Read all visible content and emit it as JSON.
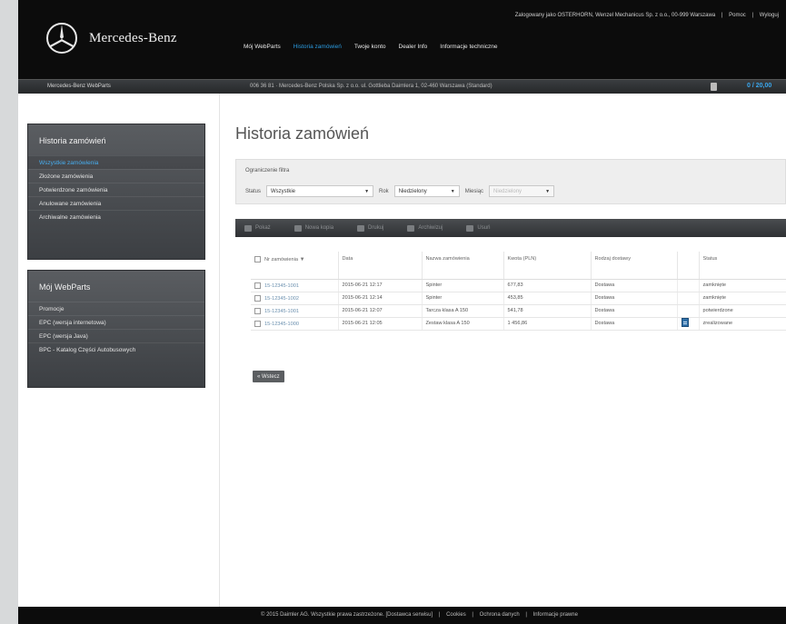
{
  "header": {
    "brand": "Mercedes-Benz",
    "user_info": "Zalogowany jako OSTERHORN, Wenzel Mechanicus Sp. z o.o., 00-999 Warszawa",
    "links": [
      "Pomoc",
      "Wyloguj"
    ],
    "nav": [
      {
        "label": "Mój WebParts",
        "active": false
      },
      {
        "label": "Historia zamówień",
        "active": true
      },
      {
        "label": "Twoje konto",
        "active": false
      },
      {
        "label": "Dealer Info",
        "active": false
      },
      {
        "label": "Informacje techniczne",
        "active": false
      }
    ]
  },
  "subbar": {
    "left": "Mercedes-Benz WebParts",
    "dealer": "006 36 81 · Mercedes-Benz Polska Sp. z o.o. ul. Gottlieba Daimlera 1, 02-460 Warszawa (Standard)",
    "cart": "0 / 20,00"
  },
  "sidebar": {
    "box1": {
      "title": "Historia zamówień",
      "items": [
        {
          "label": "Wszystkie zamówienia",
          "active": true
        },
        {
          "label": "Złożone zamówienia",
          "active": false
        },
        {
          "label": "Potwierdzone zamówienia",
          "active": false
        },
        {
          "label": "Anulowane zamówienia",
          "active": false
        },
        {
          "label": "Archiwalne zamówienia",
          "active": false
        }
      ]
    },
    "box2": {
      "title": "Mój WebParts",
      "items": [
        {
          "label": "Promocje"
        },
        {
          "label": "EPC (wersja internetowa)"
        },
        {
          "label": "EPC (wersja Java)"
        },
        {
          "label": "BPC - Katalog Części Autobusowych"
        }
      ]
    }
  },
  "main": {
    "title": "Historia zamówień",
    "filters": {
      "title": "Ograniczenie filtra",
      "status_label": "Status",
      "status_value": "Wszystkie",
      "rok_label": "Rok",
      "rok_value": "Niedzielony",
      "miesiac_label": "Miesiąc",
      "miesiac_value": "Niedzielony"
    },
    "toolbar": [
      "Pokaż",
      "Nowa kopia",
      "Drukuj",
      "Archiwizuj",
      "Usuń"
    ],
    "table": {
      "columns": [
        "Nr zamówienia",
        "Data",
        "Nazwa zamówienia",
        "Kwota (PLN)",
        "Rodzaj dostawy",
        "",
        "Status"
      ],
      "rows": [
        {
          "nr": "15-12345-1001",
          "data": "2015-06-21 12:17",
          "nazwa": "Spinter",
          "kwota": "677,83",
          "dostawa": "Dostawa",
          "doc": false,
          "status": "zamknięte"
        },
        {
          "nr": "15-12345-1002",
          "data": "2015-06-21 12:14",
          "nazwa": "Spinter",
          "kwota": "453,85",
          "dostawa": "Dostawa",
          "doc": false,
          "status": "zamknięte"
        },
        {
          "nr": "15-12345-1001",
          "data": "2015-06-21 12:07",
          "nazwa": "Tarcza klasa A 150",
          "kwota": "541,78",
          "dostawa": "Dostawa",
          "doc": false,
          "status": "potwierdzone"
        },
        {
          "nr": "15-12345-1000",
          "data": "2015-06-21 12:05",
          "nazwa": "Zestaw klasa A 150",
          "kwota": "1 456,86",
          "dostawa": "Dostawa",
          "doc": true,
          "status": "zrealizowane"
        }
      ]
    },
    "back_label": "« Wstecz"
  },
  "footer": {
    "items": [
      "© 2015 Daimler AG. Wszystkie prawa zastrzeżone. [Dostawca serwisu]",
      "Cookies",
      "Ochrona danych",
      "Informacje prawne"
    ]
  },
  "colors": {
    "accent": "#2b9be0",
    "header_bg": "#0c0c0c",
    "sidebar_bg": "#4a4d51"
  }
}
